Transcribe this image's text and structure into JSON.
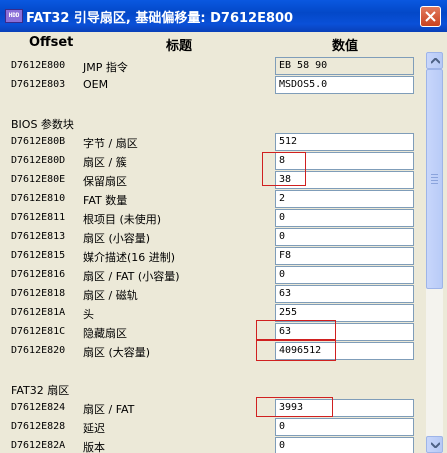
{
  "window": {
    "icon_text": "HDD",
    "title": "FAT32 引导扇区, 基础偏移量: D7612E800"
  },
  "columns": {
    "offset": "Offset",
    "title": "标题",
    "value": "数值"
  },
  "rows": [
    {
      "offset": "D7612E800",
      "title": "JMP 指令",
      "value": "EB 58 90"
    },
    {
      "offset": "D7612E803",
      "title": "OEM",
      "value": "MSDOS5.0"
    },
    {
      "offset": "D7612E80B",
      "title": "字节 / 扇区",
      "value": "512"
    },
    {
      "offset": "D7612E80D",
      "title": "扇区 / 簇",
      "value": "8"
    },
    {
      "offset": "D7612E80E",
      "title": "保留扇区",
      "value": "38"
    },
    {
      "offset": "D7612E810",
      "title": "FAT 数量",
      "value": "2"
    },
    {
      "offset": "D7612E811",
      "title": "根项目 (未使用)",
      "value": "0"
    },
    {
      "offset": "D7612E813",
      "title": "扇区 (小容量)",
      "value": "0"
    },
    {
      "offset": "D7612E815",
      "title": "媒介描述(16 进制)",
      "value": "F8"
    },
    {
      "offset": "D7612E816",
      "title": "扇区 / FAT (小容量)",
      "value": "0"
    },
    {
      "offset": "D7612E818",
      "title": "扇区 / 磁轨",
      "value": "63"
    },
    {
      "offset": "D7612E81A",
      "title": "头",
      "value": "255"
    },
    {
      "offset": "D7612E81C",
      "title": "隐藏扇区",
      "value": "63"
    },
    {
      "offset": "D7612E820",
      "title": "扇区 (大容量)",
      "value": "4096512"
    },
    {
      "offset": "D7612E824",
      "title": "扇区 / FAT",
      "value": "3993"
    },
    {
      "offset": "D7612E828",
      "title": "延迟",
      "value": "0"
    },
    {
      "offset": "D7612E82A",
      "title": "版本",
      "value": "0"
    }
  ],
  "sections": {
    "bios": "BIOS 参数块",
    "fat32": "FAT32 扇区"
  },
  "colors": {
    "titlebar": "#0348c8",
    "highlight_box": "#d02020",
    "field_border": "#7f9db9"
  },
  "icons": {
    "close": "close-icon",
    "app": "disk-editor-icon",
    "scroll_up": "scroll-up-arrow-icon",
    "scroll_down": "scroll-down-arrow-icon"
  }
}
